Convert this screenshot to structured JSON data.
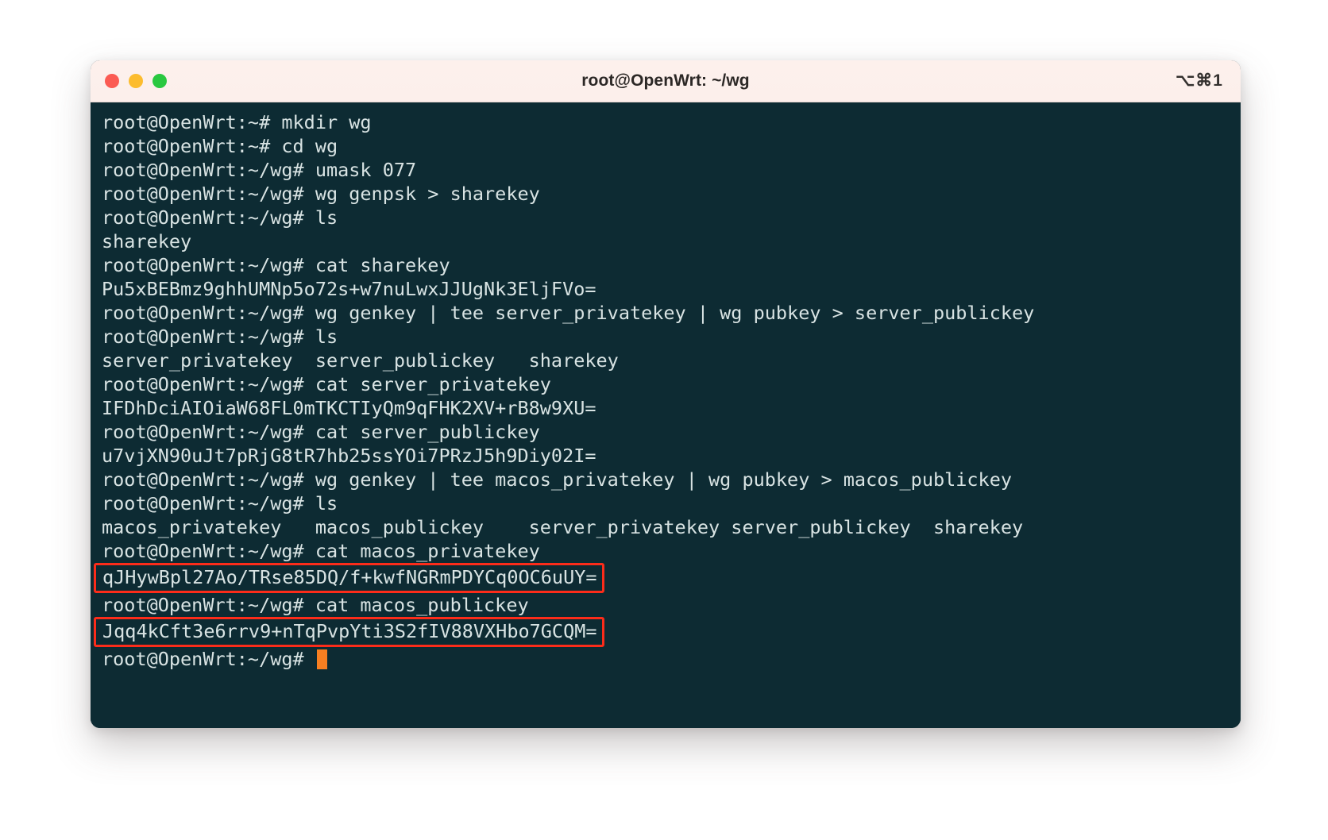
{
  "window": {
    "title": "root@OpenWrt: ~/wg",
    "shortcut": "⌥⌘1",
    "traffic_lights": [
      {
        "name": "close",
        "color": "#fb5b53"
      },
      {
        "name": "minimize",
        "color": "#fcbc2e"
      },
      {
        "name": "maximize",
        "color": "#29c840"
      }
    ]
  },
  "theme": {
    "terminal_background": "#0d2b33",
    "terminal_foreground": "#d8e3e3",
    "titlebar_background": "#fdf0ec",
    "highlight_box": "#fc2c1a",
    "cursor": "#f77f21"
  },
  "terminal": {
    "lines": [
      {
        "text": "root@OpenWrt:~# mkdir wg",
        "highlighted": false
      },
      {
        "text": "root@OpenWrt:~# cd wg",
        "highlighted": false
      },
      {
        "text": "root@OpenWrt:~/wg# umask 077",
        "highlighted": false
      },
      {
        "text": "root@OpenWrt:~/wg# wg genpsk > sharekey",
        "highlighted": false
      },
      {
        "text": "root@OpenWrt:~/wg# ls",
        "highlighted": false
      },
      {
        "text": "sharekey",
        "highlighted": false
      },
      {
        "text": "root@OpenWrt:~/wg# cat sharekey",
        "highlighted": false
      },
      {
        "text": "Pu5xBEBmz9ghhUMNp5o72s+w7nuLwxJJUgNk3EljFVo=",
        "highlighted": false
      },
      {
        "text": "root@OpenWrt:~/wg# wg genkey | tee server_privatekey | wg pubkey > server_publickey",
        "highlighted": false
      },
      {
        "text": "root@OpenWrt:~/wg# ls",
        "highlighted": false
      },
      {
        "text": "server_privatekey  server_publickey   sharekey",
        "highlighted": false
      },
      {
        "text": "root@OpenWrt:~/wg# cat server_privatekey",
        "highlighted": false
      },
      {
        "text": "IFDhDciAIOiaW68FL0mTKCTIyQm9qFHK2XV+rB8w9XU=",
        "highlighted": false
      },
      {
        "text": "root@OpenWrt:~/wg# cat server_publickey",
        "highlighted": false
      },
      {
        "text": "u7vjXN90uJt7pRjG8tR7hb25ssYOi7PRzJ5h9Diy02I=",
        "highlighted": false
      },
      {
        "text": "root@OpenWrt:~/wg# wg genkey | tee macos_privatekey | wg pubkey > macos_publickey",
        "highlighted": false
      },
      {
        "text": "root@OpenWrt:~/wg# ls",
        "highlighted": false
      },
      {
        "text": "macos_privatekey   macos_publickey    server_privatekey server_publickey  sharekey",
        "highlighted": false
      },
      {
        "text": "root@OpenWrt:~/wg# cat macos_privatekey",
        "highlighted": false
      },
      {
        "text": "qJHywBpl27Ao/TRse85DQ/f+kwfNGRmPDYCq0OC6uUY=",
        "highlighted": true
      },
      {
        "text": "root@OpenWrt:~/wg# cat macos_publickey",
        "highlighted": false
      },
      {
        "text": "Jqq4kCft3e6rrv9+nTqPvpYti3S2fIV88VXHbo7GCQM=",
        "highlighted": true
      }
    ],
    "prompt": "root@OpenWrt:~/wg# "
  }
}
